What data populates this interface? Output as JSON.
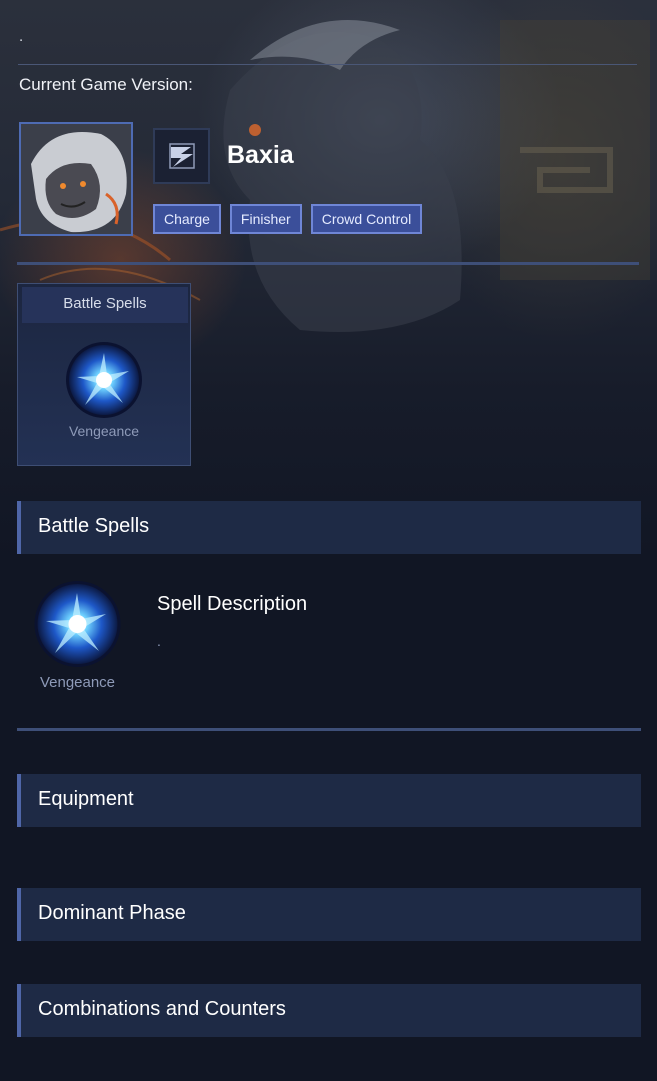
{
  "header": {
    "dot": ".",
    "version_label": "Current Game Version:"
  },
  "hero": {
    "name": "Baxia",
    "portrait_icon": "hero-portrait",
    "role_icon": "assassin-role-icon",
    "tags": [
      "Charge",
      "Finisher",
      "Crowd Control"
    ]
  },
  "spell_card": {
    "title": "Battle Spells",
    "spell_name": "Vengeance",
    "icon": "vengeance-spell-icon"
  },
  "sections": {
    "battle_spells": "Battle Spells",
    "equipment": "Equipment",
    "dominant_phase": "Dominant Phase",
    "combinations": "Combinations and Counters"
  },
  "spell_detail": {
    "spell_name": "Vengeance",
    "description_title": "Spell Description",
    "description_text": "."
  },
  "colors": {
    "background": "#111624",
    "accent": "#4f66a8",
    "tag_fill": "#3b4f9a",
    "section_fill": "#1e2a45"
  }
}
